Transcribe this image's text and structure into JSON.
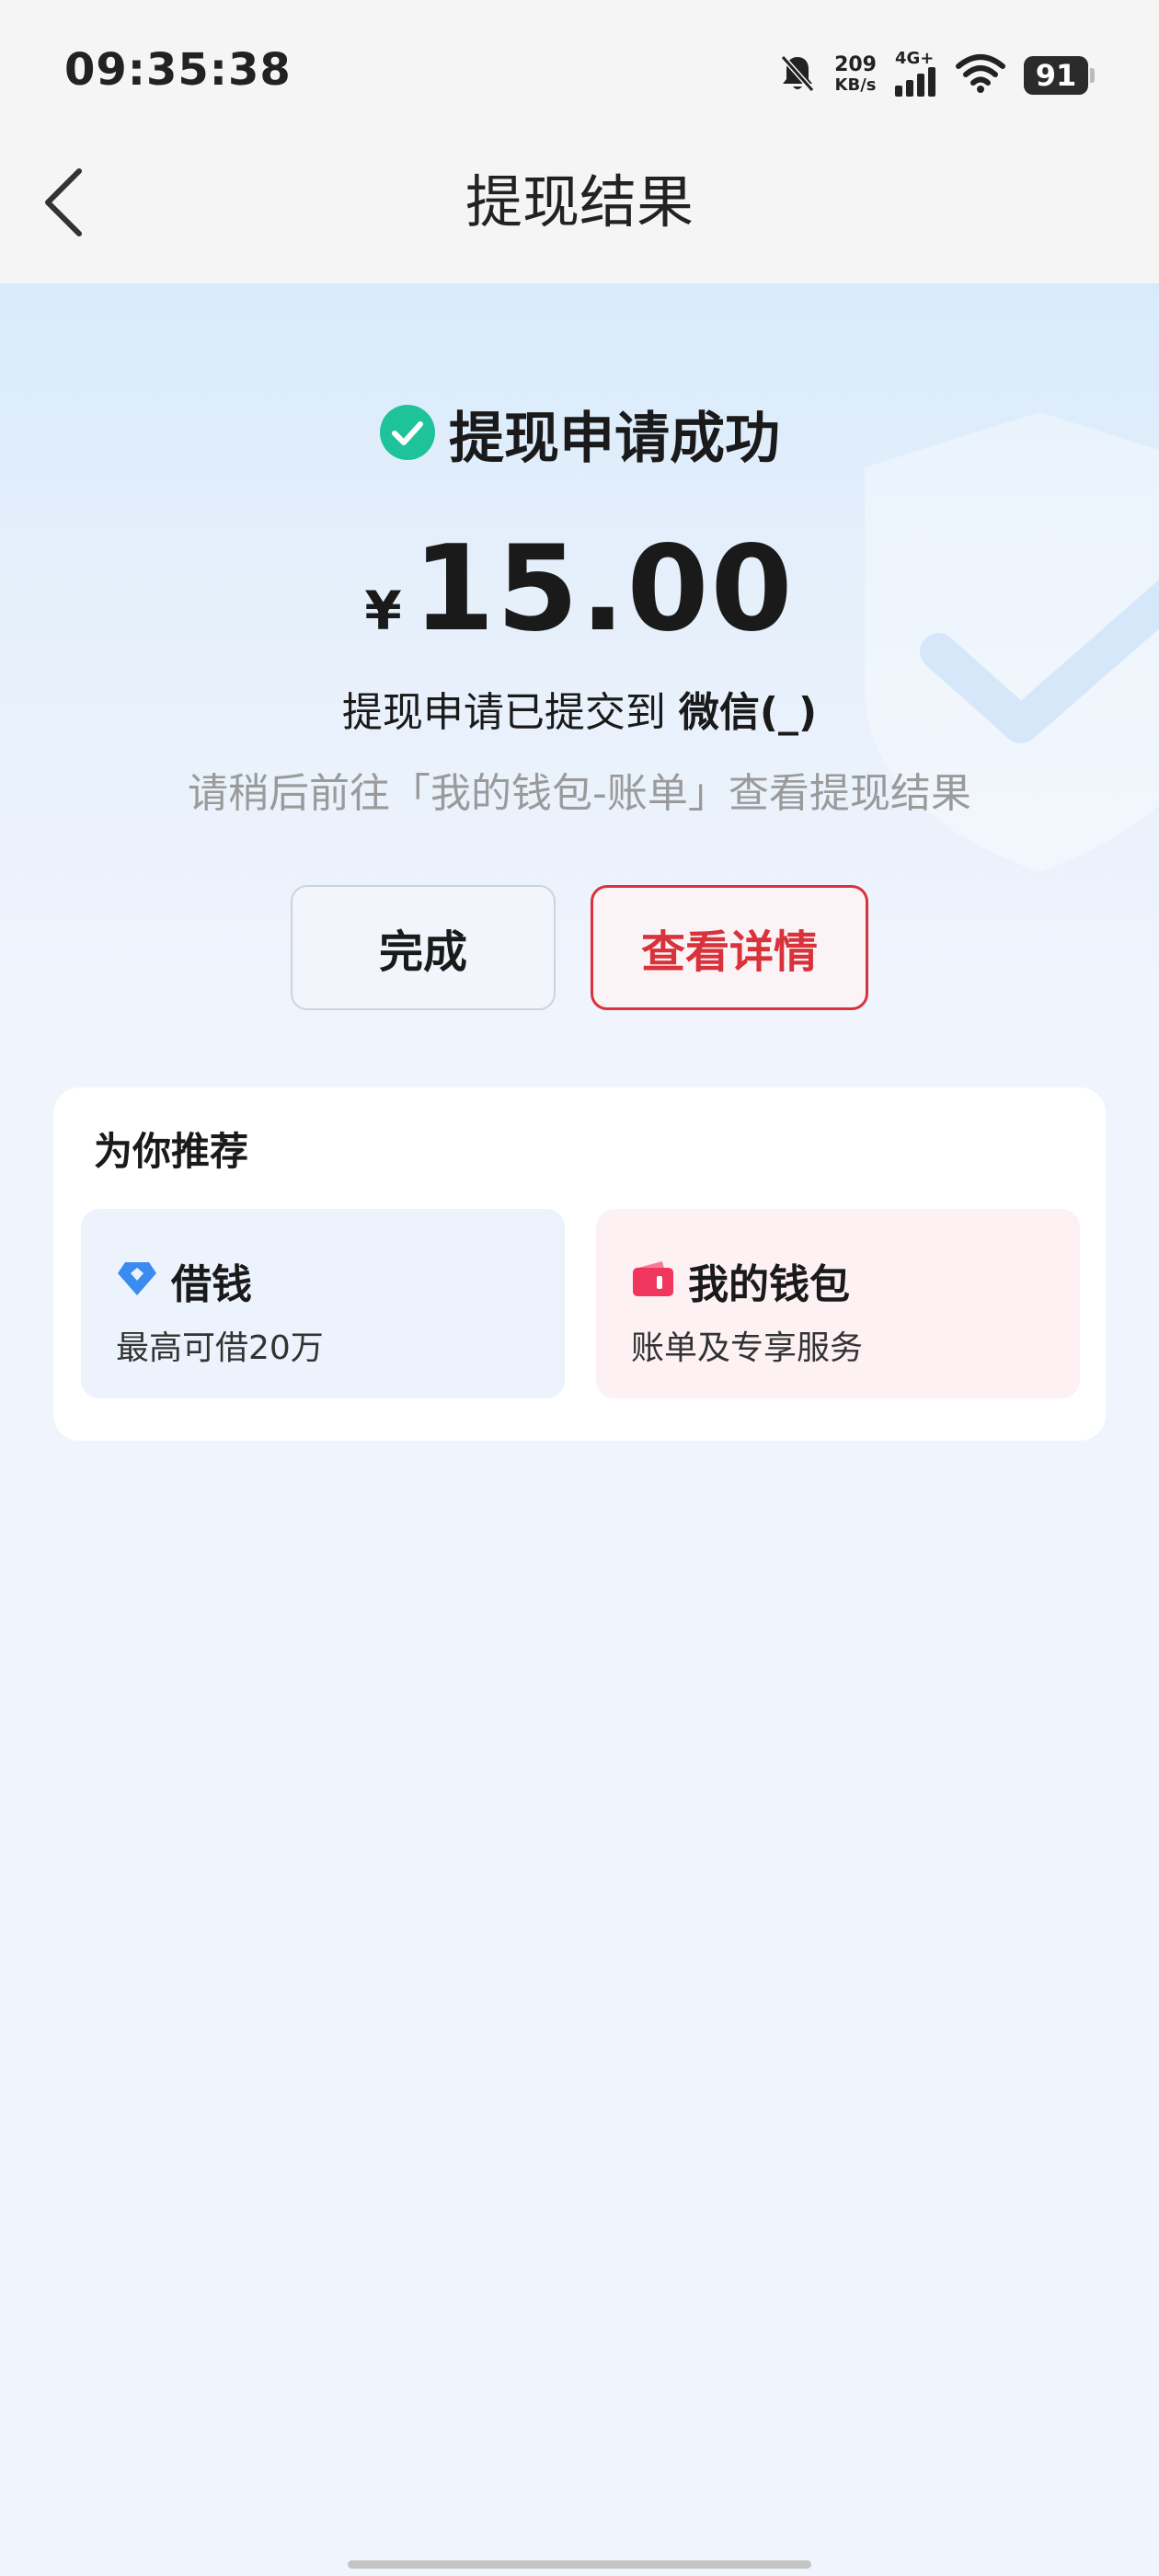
{
  "status_bar": {
    "time": "09:35:38",
    "net_speed_value": "209",
    "net_speed_unit": "KB/s",
    "signal_label": "4G+",
    "battery": "91"
  },
  "header": {
    "title": "提现结果",
    "back_icon": "chevron-left-icon"
  },
  "result": {
    "status_icon": "check-circle-icon",
    "status_title": "提现申请成功",
    "currency_symbol": "¥",
    "amount": "15.00",
    "submit_prefix": "提现申请已提交到 ",
    "submit_target": "微信(_)",
    "hint": "请稍后前往「我的钱包-账单」查看提现结果"
  },
  "actions": {
    "done_label": "完成",
    "detail_label": "查看详情"
  },
  "recommend": {
    "title": "为你推荐",
    "items": [
      {
        "icon": "diamond-icon",
        "title": "借钱",
        "subtitle": "最高可借20万"
      },
      {
        "icon": "wallet-icon",
        "title": "我的钱包",
        "subtitle": "账单及专享服务"
      }
    ]
  },
  "colors": {
    "accent_red": "#d8323b",
    "success_green": "#1fc39a",
    "diamond_blue": "#3b8cf0",
    "wallet_pink": "#f0365c"
  }
}
